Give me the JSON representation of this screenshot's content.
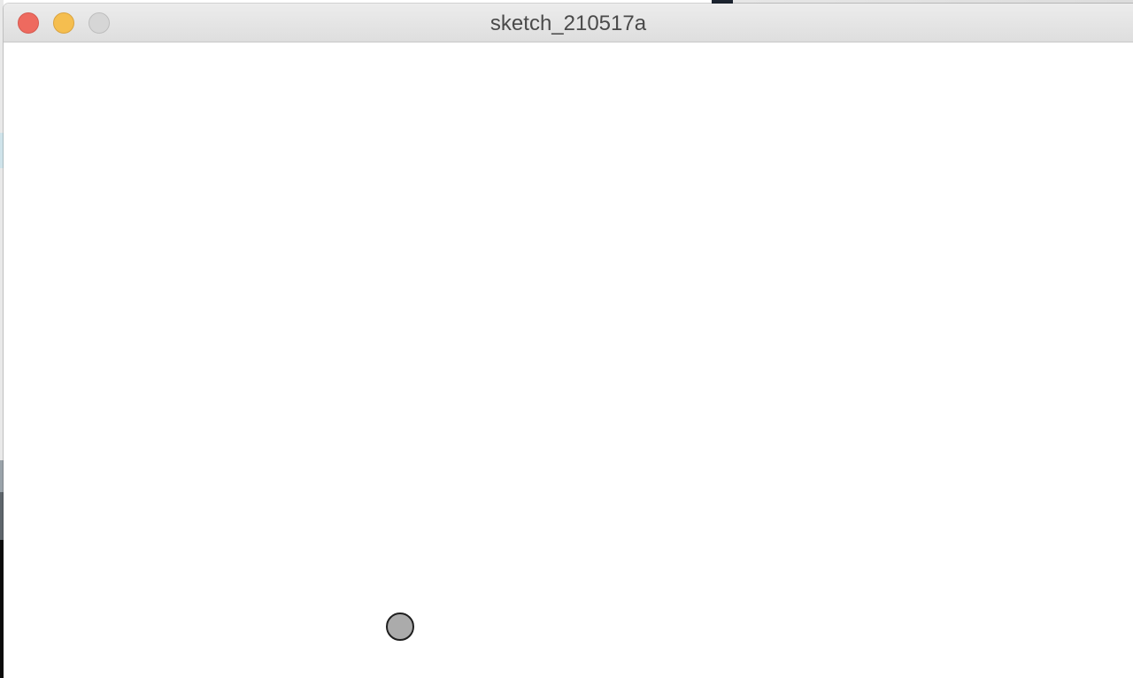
{
  "window": {
    "title": "sketch_210517a",
    "controls": {
      "close": "close-button",
      "minimize": "minimize-button",
      "zoom": "zoom-button"
    }
  },
  "colors": {
    "close": "#ee6a5f",
    "minimize": "#f5be4f",
    "zoom": "#d6d6d6",
    "canvas_background": "#ffffff",
    "ball_fill": "#ababab",
    "ball_stroke": "#1f1f1f"
  },
  "canvas": {
    "shapes": [
      {
        "name": "ball",
        "kind": "circle"
      }
    ]
  }
}
